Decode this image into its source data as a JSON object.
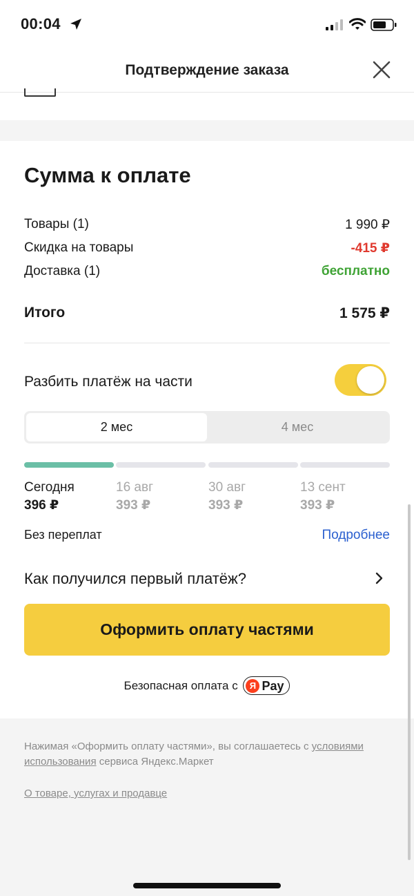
{
  "status_bar": {
    "time": "00:04",
    "location_icon": "location-arrow-icon",
    "signal_icon": "cellular-signal-icon",
    "wifi_icon": "wifi-icon",
    "battery_icon": "battery-icon"
  },
  "header": {
    "title": "Подтверждение заказа",
    "close_icon": "close-icon"
  },
  "summary": {
    "title": "Сумма к оплате",
    "items": [
      {
        "label": "Товары (1)",
        "value": "1 990 ₽",
        "style": "normal"
      },
      {
        "label": "Скидка на товары",
        "value": "-415 ₽",
        "style": "discount"
      },
      {
        "label": "Доставка (1)",
        "value": "бесплатно",
        "style": "free"
      }
    ],
    "total": {
      "label": "Итого",
      "value": "1 575 ₽"
    }
  },
  "split": {
    "label": "Разбить платёж на части",
    "enabled": true,
    "tabs": [
      {
        "label": "2 мес",
        "active": true
      },
      {
        "label": "4 мес",
        "active": false
      }
    ],
    "schedule": [
      {
        "date": "Сегодня",
        "amount": "396 ₽",
        "paid": true
      },
      {
        "date": "16 авг",
        "amount": "393 ₽",
        "paid": false
      },
      {
        "date": "30 авг",
        "amount": "393 ₽",
        "paid": false
      },
      {
        "date": "13 сент",
        "amount": "393 ₽",
        "paid": false
      }
    ],
    "no_overpay": "Без переплат",
    "more_link": "Подробнее",
    "how_first_payment": "Как получился первый платёж?"
  },
  "cta": {
    "label": "Оформить оплату частями"
  },
  "secure": {
    "text": "Безопасная оплата с",
    "logo_letter": "Я",
    "logo_word": "Pay"
  },
  "footer": {
    "agree_prefix": "Нажимая «Оформить оплату частями», вы соглашаетесь с ",
    "agree_link": "условиями использования",
    "agree_suffix": " сервиса Яндекс.Маркет",
    "about_link": "О товаре, услугах и продавце"
  },
  "colors": {
    "accent_yellow": "#f5cd3f",
    "discount_red": "#e03a2f",
    "free_green": "#3fa335",
    "link_blue": "#2a5fcf",
    "progress_done": "#6bbfa6"
  }
}
